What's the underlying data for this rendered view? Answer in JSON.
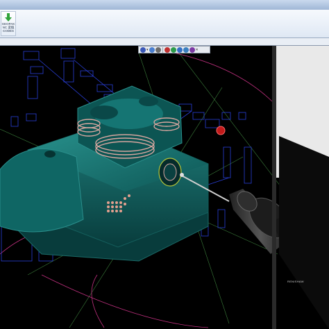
{
  "toolbar": {
    "button_line1": "GEOPAK",
    "button_line2": "NC 変換",
    "button_line3": "CODES"
  },
  "viewport": {
    "probe_brand": "RENISHAW",
    "toolbar_buttons": [
      "view-icon",
      "rotate-icon",
      "zoom-icon",
      "color-icon",
      "render-icon",
      "shade-icon",
      "wireframe-icon",
      "probe-icon",
      "close-icon"
    ]
  },
  "colors": {
    "part_body": "#0e5a5a",
    "part_highlight": "#2b8f8c",
    "dimension_lines": "#2a3fd8",
    "probe_path": "#d33a8e",
    "guide_lines": "#3b7d3b",
    "coil": "#d8a7a0",
    "background": "#000000"
  }
}
